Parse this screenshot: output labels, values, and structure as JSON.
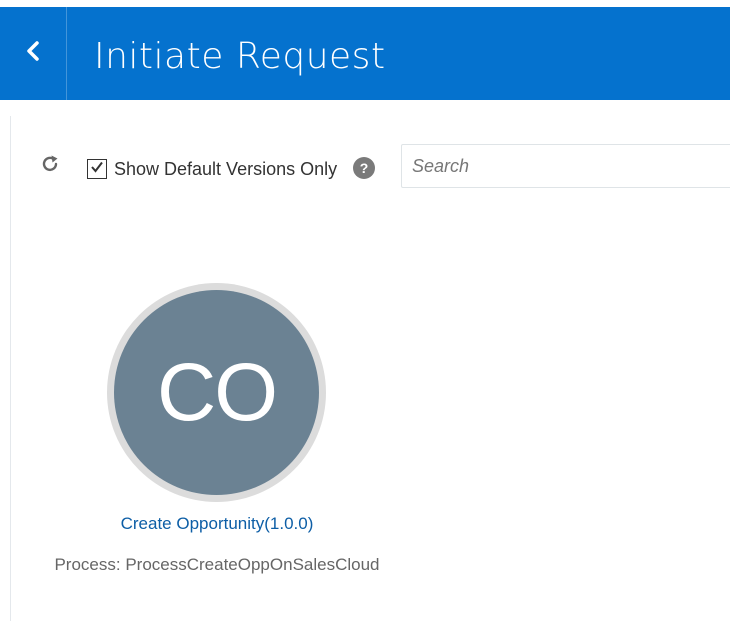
{
  "header": {
    "title": "Initiate Request",
    "background_color": "#0572ce",
    "back_icon": "chevron-left-icon"
  },
  "toolbar": {
    "refresh_icon": "refresh-icon",
    "show_default_label": "Show Default Versions Only",
    "show_default_checked": true,
    "help_glyph": "?",
    "search_placeholder": "Search",
    "search_value": ""
  },
  "cards": [
    {
      "initials": "CO",
      "avatar_color": "#6b8293",
      "title": "Create Opportunity(1.0.0)",
      "process": "Process: ProcessCreateOppOnSalesCloud"
    }
  ]
}
